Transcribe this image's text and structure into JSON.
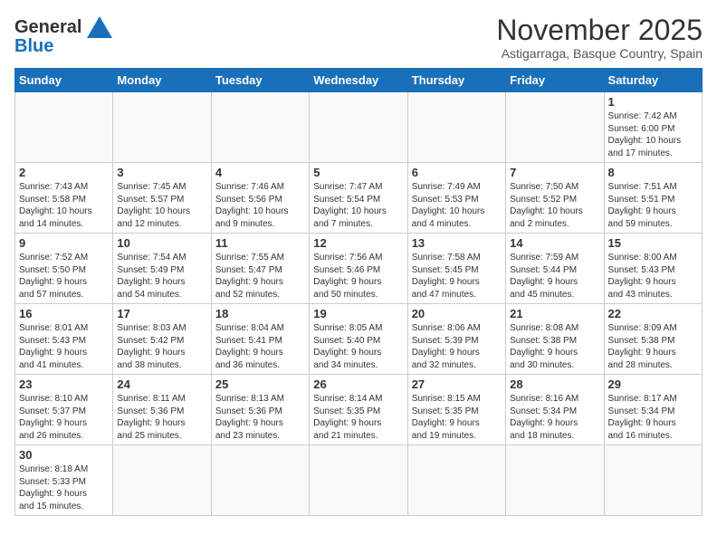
{
  "header": {
    "logo_general": "General",
    "logo_blue": "Blue",
    "month_title": "November 2025",
    "location": "Astigarraga, Basque Country, Spain"
  },
  "days_of_week": [
    "Sunday",
    "Monday",
    "Tuesday",
    "Wednesday",
    "Thursday",
    "Friday",
    "Saturday"
  ],
  "weeks": [
    [
      {
        "day": "",
        "text": ""
      },
      {
        "day": "",
        "text": ""
      },
      {
        "day": "",
        "text": ""
      },
      {
        "day": "",
        "text": ""
      },
      {
        "day": "",
        "text": ""
      },
      {
        "day": "",
        "text": ""
      },
      {
        "day": "1",
        "text": "Sunrise: 7:42 AM\nSunset: 6:00 PM\nDaylight: 10 hours\nand 17 minutes."
      }
    ],
    [
      {
        "day": "2",
        "text": "Sunrise: 7:43 AM\nSunset: 5:58 PM\nDaylight: 10 hours\nand 14 minutes."
      },
      {
        "day": "3",
        "text": "Sunrise: 7:45 AM\nSunset: 5:57 PM\nDaylight: 10 hours\nand 12 minutes."
      },
      {
        "day": "4",
        "text": "Sunrise: 7:46 AM\nSunset: 5:56 PM\nDaylight: 10 hours\nand 9 minutes."
      },
      {
        "day": "5",
        "text": "Sunrise: 7:47 AM\nSunset: 5:54 PM\nDaylight: 10 hours\nand 7 minutes."
      },
      {
        "day": "6",
        "text": "Sunrise: 7:49 AM\nSunset: 5:53 PM\nDaylight: 10 hours\nand 4 minutes."
      },
      {
        "day": "7",
        "text": "Sunrise: 7:50 AM\nSunset: 5:52 PM\nDaylight: 10 hours\nand 2 minutes."
      },
      {
        "day": "8",
        "text": "Sunrise: 7:51 AM\nSunset: 5:51 PM\nDaylight: 9 hours\nand 59 minutes."
      }
    ],
    [
      {
        "day": "9",
        "text": "Sunrise: 7:52 AM\nSunset: 5:50 PM\nDaylight: 9 hours\nand 57 minutes."
      },
      {
        "day": "10",
        "text": "Sunrise: 7:54 AM\nSunset: 5:49 PM\nDaylight: 9 hours\nand 54 minutes."
      },
      {
        "day": "11",
        "text": "Sunrise: 7:55 AM\nSunset: 5:47 PM\nDaylight: 9 hours\nand 52 minutes."
      },
      {
        "day": "12",
        "text": "Sunrise: 7:56 AM\nSunset: 5:46 PM\nDaylight: 9 hours\nand 50 minutes."
      },
      {
        "day": "13",
        "text": "Sunrise: 7:58 AM\nSunset: 5:45 PM\nDaylight: 9 hours\nand 47 minutes."
      },
      {
        "day": "14",
        "text": "Sunrise: 7:59 AM\nSunset: 5:44 PM\nDaylight: 9 hours\nand 45 minutes."
      },
      {
        "day": "15",
        "text": "Sunrise: 8:00 AM\nSunset: 5:43 PM\nDaylight: 9 hours\nand 43 minutes."
      }
    ],
    [
      {
        "day": "16",
        "text": "Sunrise: 8:01 AM\nSunset: 5:43 PM\nDaylight: 9 hours\nand 41 minutes."
      },
      {
        "day": "17",
        "text": "Sunrise: 8:03 AM\nSunset: 5:42 PM\nDaylight: 9 hours\nand 38 minutes."
      },
      {
        "day": "18",
        "text": "Sunrise: 8:04 AM\nSunset: 5:41 PM\nDaylight: 9 hours\nand 36 minutes."
      },
      {
        "day": "19",
        "text": "Sunrise: 8:05 AM\nSunset: 5:40 PM\nDaylight: 9 hours\nand 34 minutes."
      },
      {
        "day": "20",
        "text": "Sunrise: 8:06 AM\nSunset: 5:39 PM\nDaylight: 9 hours\nand 32 minutes."
      },
      {
        "day": "21",
        "text": "Sunrise: 8:08 AM\nSunset: 5:38 PM\nDaylight: 9 hours\nand 30 minutes."
      },
      {
        "day": "22",
        "text": "Sunrise: 8:09 AM\nSunset: 5:38 PM\nDaylight: 9 hours\nand 28 minutes."
      }
    ],
    [
      {
        "day": "23",
        "text": "Sunrise: 8:10 AM\nSunset: 5:37 PM\nDaylight: 9 hours\nand 26 minutes."
      },
      {
        "day": "24",
        "text": "Sunrise: 8:11 AM\nSunset: 5:36 PM\nDaylight: 9 hours\nand 25 minutes."
      },
      {
        "day": "25",
        "text": "Sunrise: 8:13 AM\nSunset: 5:36 PM\nDaylight: 9 hours\nand 23 minutes."
      },
      {
        "day": "26",
        "text": "Sunrise: 8:14 AM\nSunset: 5:35 PM\nDaylight: 9 hours\nand 21 minutes."
      },
      {
        "day": "27",
        "text": "Sunrise: 8:15 AM\nSunset: 5:35 PM\nDaylight: 9 hours\nand 19 minutes."
      },
      {
        "day": "28",
        "text": "Sunrise: 8:16 AM\nSunset: 5:34 PM\nDaylight: 9 hours\nand 18 minutes."
      },
      {
        "day": "29",
        "text": "Sunrise: 8:17 AM\nSunset: 5:34 PM\nDaylight: 9 hours\nand 16 minutes."
      }
    ],
    [
      {
        "day": "30",
        "text": "Sunrise: 8:18 AM\nSunset: 5:33 PM\nDaylight: 9 hours\nand 15 minutes."
      },
      {
        "day": "",
        "text": ""
      },
      {
        "day": "",
        "text": ""
      },
      {
        "day": "",
        "text": ""
      },
      {
        "day": "",
        "text": ""
      },
      {
        "day": "",
        "text": ""
      },
      {
        "day": "",
        "text": ""
      }
    ]
  ]
}
